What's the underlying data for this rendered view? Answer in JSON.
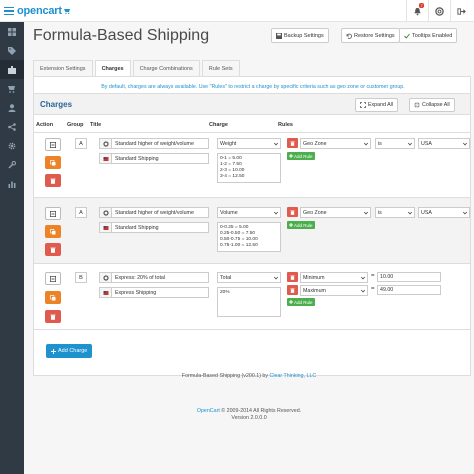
{
  "brand": {
    "logo": "opencart",
    "accent": "#1e91cf"
  },
  "topbar": {
    "notification_count": "7",
    "icons": [
      "bell-icon",
      "life-ring-icon",
      "sign-out-icon"
    ]
  },
  "sidebar": {
    "icons": [
      "dashboard-icon",
      "tag-icon",
      "puzzle-icon",
      "cart-icon",
      "user-icon",
      "share-icon",
      "gear-icon",
      "wrench-icon",
      "bar-chart-icon"
    ]
  },
  "page": {
    "title": "Formula-Based Shipping",
    "buttons": {
      "backup": "Backup Settings",
      "restore": "Restore Settings",
      "tooltips": "Tooltips Enabled"
    }
  },
  "tabs": [
    "Extension Settings",
    "Charges",
    "Charge Combinations",
    "Rule Sets"
  ],
  "active_tab": "Charges",
  "info": "By default, charges are always available. Use \"Rules\" to restrict a charge by specific criteria such as geo zone or customer group.",
  "charges_panel": {
    "title": "Charges",
    "expand_all": "Expand All",
    "collapse_all": "Collapse All",
    "columns": {
      "action": "Action",
      "group": "Group",
      "title": "Title",
      "charge": "Charge",
      "rules": "Rules"
    },
    "add_rule": "Add Rule",
    "add_charge": "Add Charge"
  },
  "charges": [
    {
      "group": "A",
      "admin_title": "Standard higher of weight/volume",
      "front_title": "Standard Shipping",
      "charge_type": "Weight",
      "formula": "0-1 = 5.00\n1-2 = 7.50\n2-3 = 10.00\n3-4 = 12.50",
      "rules": [
        {
          "field": "Geo Zone",
          "op": "is",
          "value": "USA"
        }
      ]
    },
    {
      "group": "A",
      "admin_title": "Standard higher of weight/volume",
      "front_title": "Standard Shipping",
      "charge_type": "Volume",
      "formula": "0-0.25 = 5.00\n0.25-0.50 = 7.50\n0.50-0.75 = 10.00\n0.75-1.00 = 12.50",
      "rules": [
        {
          "field": "Geo Zone",
          "op": "is",
          "value": "USA"
        }
      ]
    },
    {
      "group": "B",
      "admin_title": "Express: 20% of total",
      "front_title": "Express Shipping",
      "charge_type": "Total",
      "formula": "20%",
      "rules": [
        {
          "field": "Minimum",
          "op": "=",
          "value": "10.00"
        },
        {
          "field": "Maximum",
          "op": "=",
          "value": "49.00"
        }
      ]
    }
  ],
  "footer": {
    "line_prefix": "Formula-Based Shipping (v200.1) by ",
    "line_link": "Clear Thinking, LLC",
    "copy_link": "OpenCart",
    "copy_rest": " © 2009-2014 All Rights Reserved.",
    "version": "Version 2.0.0.0"
  }
}
